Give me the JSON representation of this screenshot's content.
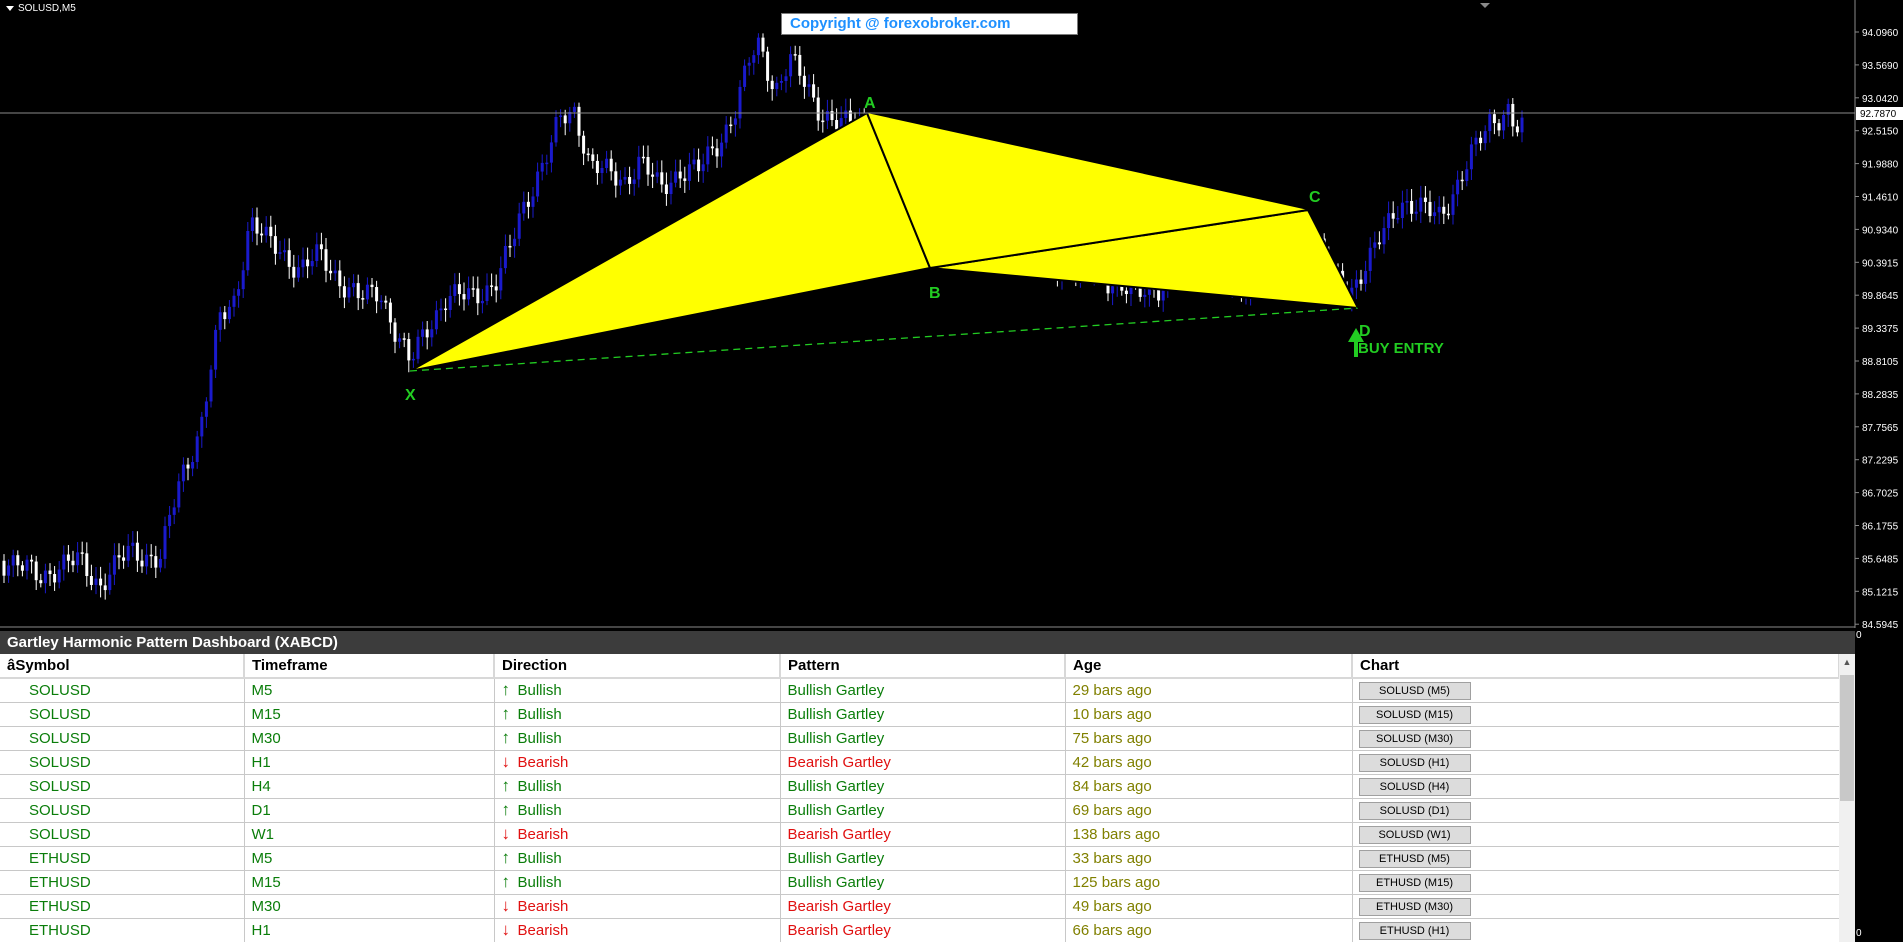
{
  "chart": {
    "symbol_timeframe": "SOLUSD,M5",
    "copyright": "Copyright @ forexobroker.com",
    "current_price": "92.7870",
    "price_ticks": [
      "94.0960",
      "93.5690",
      "93.0420",
      "92.5150",
      "91.9880",
      "91.4610",
      "90.9340",
      "90.3915",
      "89.8645",
      "89.3375",
      "88.8105",
      "88.2835",
      "87.7565",
      "87.2295",
      "86.7025",
      "86.1755",
      "85.6485",
      "85.1215",
      "84.5945"
    ],
    "points": {
      "x": "X",
      "a": "A",
      "b": "B",
      "c": "C",
      "d": "D"
    },
    "signal": "BUY ENTRY",
    "colors": {
      "pattern_fill": "#ffff00",
      "labels": "#22cc22",
      "bull_candle": "#1a1acc",
      "background": "#000000"
    },
    "side_zero_top": "0",
    "side_zero_bottom": "0"
  },
  "dashboard": {
    "title": "Gartley Harmonic Pattern Dashboard (XABCD)",
    "headers": [
      "âSymbol",
      "Timeframe",
      "Direction",
      "Pattern",
      "Age",
      "Chart"
    ],
    "rows": [
      {
        "symbol": "SOLUSD",
        "tf": "M5",
        "dir": "Bullish",
        "pattern": "Bullish Gartley",
        "age": "29 bars ago",
        "btn": "SOLUSD (M5)"
      },
      {
        "symbol": "SOLUSD",
        "tf": "M15",
        "dir": "Bullish",
        "pattern": "Bullish Gartley",
        "age": "10 bars ago",
        "btn": "SOLUSD (M15)"
      },
      {
        "symbol": "SOLUSD",
        "tf": "M30",
        "dir": "Bullish",
        "pattern": "Bullish Gartley",
        "age": "75 bars ago",
        "btn": "SOLUSD (M30)"
      },
      {
        "symbol": "SOLUSD",
        "tf": "H1",
        "dir": "Bearish",
        "pattern": "Bearish Gartley",
        "age": "42 bars ago",
        "btn": "SOLUSD (H1)"
      },
      {
        "symbol": "SOLUSD",
        "tf": "H4",
        "dir": "Bullish",
        "pattern": "Bullish Gartley",
        "age": "84 bars ago",
        "btn": "SOLUSD (H4)"
      },
      {
        "symbol": "SOLUSD",
        "tf": "D1",
        "dir": "Bullish",
        "pattern": "Bullish Gartley",
        "age": "69 bars ago",
        "btn": "SOLUSD (D1)"
      },
      {
        "symbol": "SOLUSD",
        "tf": "W1",
        "dir": "Bearish",
        "pattern": "Bearish Gartley",
        "age": "138 bars ago",
        "btn": "SOLUSD (W1)"
      },
      {
        "symbol": "ETHUSD",
        "tf": "M5",
        "dir": "Bullish",
        "pattern": "Bullish Gartley",
        "age": "33 bars ago",
        "btn": "ETHUSD (M5)"
      },
      {
        "symbol": "ETHUSD",
        "tf": "M15",
        "dir": "Bullish",
        "pattern": "Bullish Gartley",
        "age": "125 bars ago",
        "btn": "ETHUSD (M15)"
      },
      {
        "symbol": "ETHUSD",
        "tf": "M30",
        "dir": "Bearish",
        "pattern": "Bearish Gartley",
        "age": "49 bars ago",
        "btn": "ETHUSD (M30)"
      },
      {
        "symbol": "ETHUSD",
        "tf": "H1",
        "dir": "Bearish",
        "pattern": "Bearish Gartley",
        "age": "66 bars ago",
        "btn": "ETHUSD (H1)"
      }
    ]
  }
}
